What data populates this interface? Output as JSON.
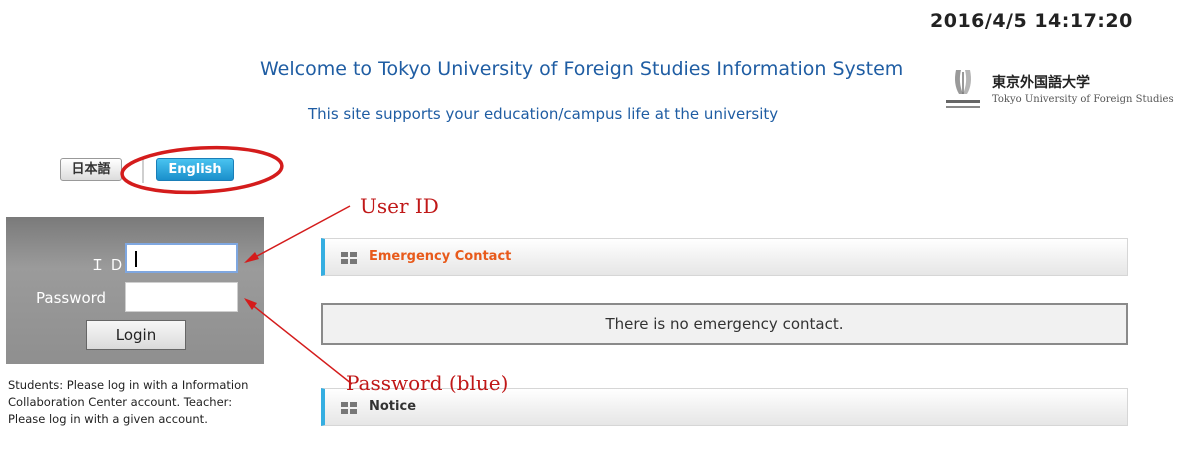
{
  "header": {
    "timestamp": "2016/4/5 14:17:20",
    "welcome": "Welcome to Tokyo University of Foreign Studies Information System",
    "tagline": "This site supports your education/campus life at the university"
  },
  "university": {
    "name_jp": "東京外国語大学",
    "name_en": "Tokyo University of Foreign Studies"
  },
  "language_switch": {
    "japanese_label": "日本語",
    "english_label": "English",
    "selected": "English"
  },
  "login": {
    "id_label": "ＩＤ",
    "password_label": "Password",
    "id_value": "",
    "password_value": "",
    "button_label": "Login",
    "note": "Students: Please log in with a Information Collaboration Center account. Teacher: Please log in with a given account."
  },
  "panels": {
    "emergency_title": "Emergency Contact",
    "emergency_message": "There is no emergency contact.",
    "notice_title": "Notice"
  },
  "annotations": {
    "user_id": "User ID",
    "password": "Password (blue)"
  },
  "colors": {
    "accent_blue": "#35aee1",
    "title_blue": "#1f5da3",
    "emergency_orange": "#e85a1b",
    "annotation_red": "#c01818"
  }
}
